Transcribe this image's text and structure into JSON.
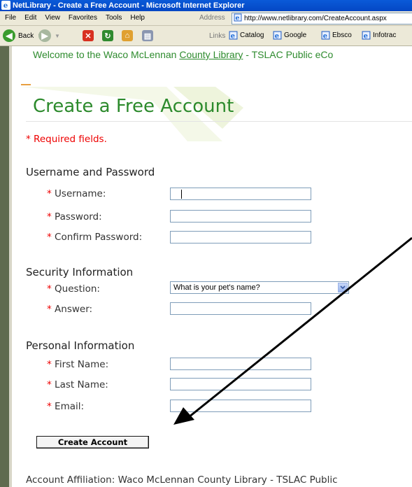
{
  "window": {
    "title": "NetLibrary - Create a Free Account - Microsoft Internet Explorer"
  },
  "menu": [
    "File",
    "Edit",
    "View",
    "Favorites",
    "Tools",
    "Help"
  ],
  "address": {
    "label": "Address",
    "url": "http://www.netlibrary.com/CreateAccount.aspx"
  },
  "toolbar": {
    "back_label": "Back",
    "links_label": "Links",
    "links": [
      "Catalog",
      "Google",
      "Ebsco",
      "Infotrac"
    ]
  },
  "page": {
    "welcome_prefix": "Welcome to the Waco McLennan ",
    "welcome_link": "County Library",
    "welcome_suffix": " - TSLAC Public eCo",
    "title": "Create a Free Account",
    "required_note": "Required fields.",
    "asterisk": "*"
  },
  "sections": {
    "credentials": {
      "heading": "Username and Password",
      "username_label": "Username:",
      "password_label": "Password:",
      "confirm_label": "Confirm Password:"
    },
    "security": {
      "heading": "Security Information",
      "question_label": "Question:",
      "question_value": "What is your pet's name?",
      "answer_label": "Answer:"
    },
    "personal": {
      "heading": "Personal Information",
      "first_name_label": "First Name:",
      "last_name_label": "Last Name:",
      "email_label": "Email:"
    }
  },
  "form": {
    "submit_label": "Create Account"
  },
  "affiliation": {
    "label": "Account Affiliation:",
    "value": "Waco McLennan County Library - TSLAC Public"
  },
  "colors": {
    "title_green": "#2c8a2c",
    "required_red": "#e00000",
    "xp_blue": "#0a5ad8"
  }
}
